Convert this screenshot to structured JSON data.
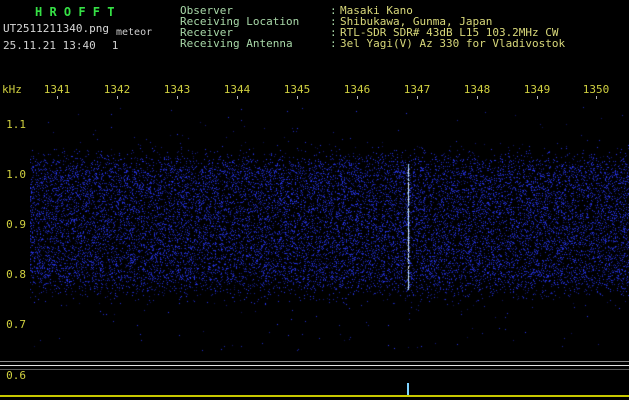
{
  "app": {
    "title": "H R O F F T",
    "filename": "UT2511211340.png",
    "mode_label": "meteor",
    "datetime": "25.11.21 13:40",
    "counter": "1"
  },
  "station": {
    "colon": ":",
    "rows": [
      {
        "label": "Observer",
        "value": "Masaki Kano"
      },
      {
        "label": "Receiving Location",
        "value": "Shibukawa, Gunma, Japan"
      },
      {
        "label": "Receiver",
        "value": "RTL-SDR SDR# 43dB L15 103.2MHz CW"
      },
      {
        "label": "Receiving Antenna",
        "value": "3el Yagi(V) Az 330 for Vladivostok"
      }
    ]
  },
  "axes": {
    "y_unit": "kHz",
    "y_ticks": [
      "1.1",
      "1.0",
      "0.9",
      "0.8",
      "0.7",
      "0.6"
    ],
    "x_ticks": [
      "1341",
      "1342",
      "1343",
      "1344",
      "1345",
      "1346",
      "1347",
      "1348",
      "1349",
      "1350"
    ]
  },
  "signal": {
    "noise_band_khz": [
      0.8,
      1.0
    ],
    "echo": {
      "x_time": 1346.85,
      "khz_range": [
        0.77,
        1.02
      ]
    }
  },
  "colors": {
    "title_green": "#35e045",
    "label_green": "#a8d8a8",
    "value_yellow": "#d8d87a",
    "axis_yellow": "#d0d040",
    "noise_blue": "#2020c8",
    "echo_cyan": "#aee6ff",
    "baseline_yellow": "#c8c800",
    "level_line": "#e2e2e2"
  }
}
